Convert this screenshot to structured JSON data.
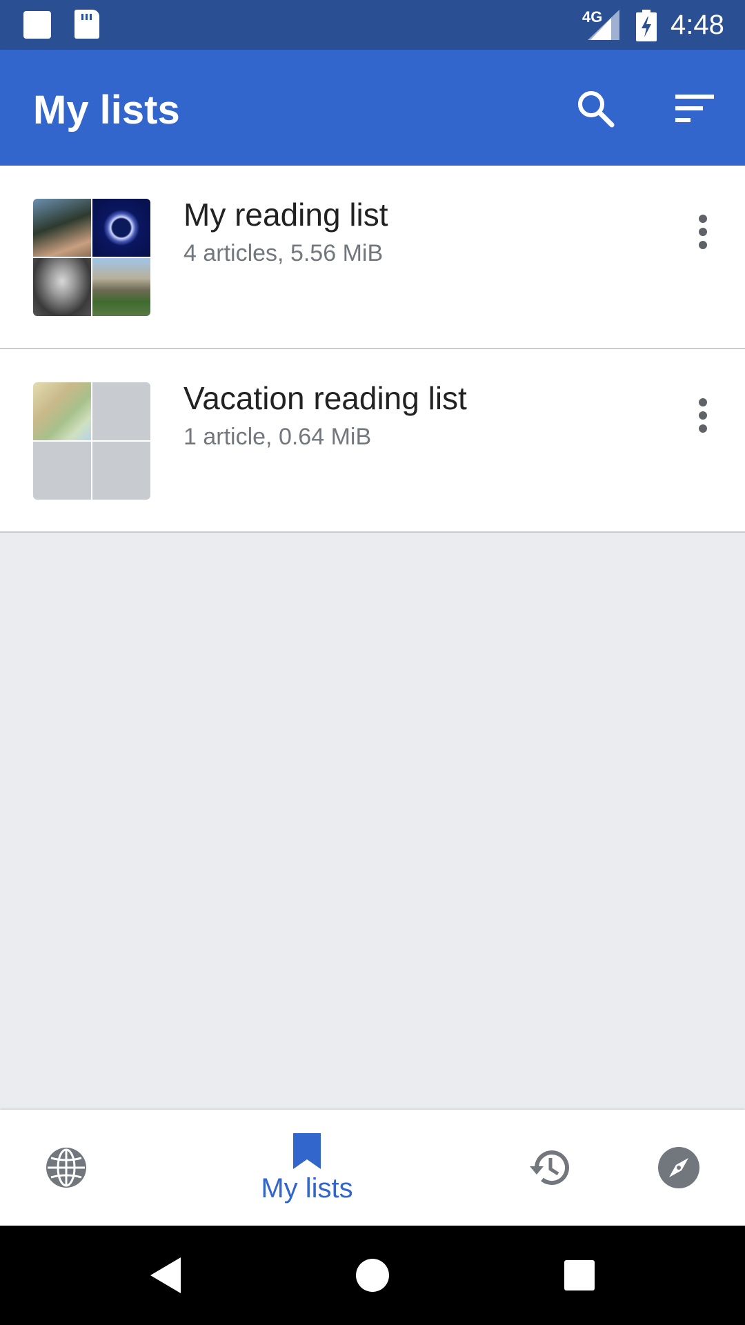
{
  "status_bar": {
    "network": "4G",
    "time": "4:48"
  },
  "app_bar": {
    "title": "My lists"
  },
  "lists": [
    {
      "title": "My reading list",
      "subtitle": "4 articles, 5.56 MiB"
    },
    {
      "title": "Vacation reading list",
      "subtitle": "1 article, 0.64 MiB"
    }
  ],
  "bottom_nav": {
    "active_label": "My lists"
  },
  "colors": {
    "accent": "#3366cc",
    "status_bar": "#2b4f93",
    "background": "#eaecf0"
  },
  "icons": [
    "search-icon",
    "sort-icon",
    "more-vert-icon",
    "globe-icon",
    "bookmark-icon",
    "history-icon",
    "compass-icon",
    "back-icon",
    "home-icon",
    "recents-icon"
  ]
}
